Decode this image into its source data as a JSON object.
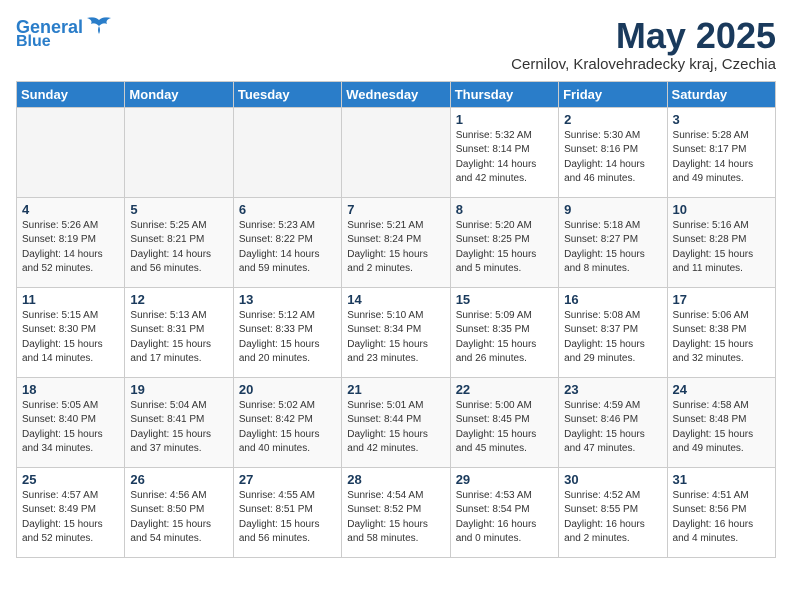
{
  "header": {
    "logo_line1": "General",
    "logo_line2": "Blue",
    "title": "May 2025",
    "subtitle": "Cernilov, Kralovehradecky kraj, Czechia"
  },
  "weekdays": [
    "Sunday",
    "Monday",
    "Tuesday",
    "Wednesday",
    "Thursday",
    "Friday",
    "Saturday"
  ],
  "weeks": [
    [
      {
        "day": "",
        "info": ""
      },
      {
        "day": "",
        "info": ""
      },
      {
        "day": "",
        "info": ""
      },
      {
        "day": "",
        "info": ""
      },
      {
        "day": "1",
        "info": "Sunrise: 5:32 AM\nSunset: 8:14 PM\nDaylight: 14 hours\nand 42 minutes."
      },
      {
        "day": "2",
        "info": "Sunrise: 5:30 AM\nSunset: 8:16 PM\nDaylight: 14 hours\nand 46 minutes."
      },
      {
        "day": "3",
        "info": "Sunrise: 5:28 AM\nSunset: 8:17 PM\nDaylight: 14 hours\nand 49 minutes."
      }
    ],
    [
      {
        "day": "4",
        "info": "Sunrise: 5:26 AM\nSunset: 8:19 PM\nDaylight: 14 hours\nand 52 minutes."
      },
      {
        "day": "5",
        "info": "Sunrise: 5:25 AM\nSunset: 8:21 PM\nDaylight: 14 hours\nand 56 minutes."
      },
      {
        "day": "6",
        "info": "Sunrise: 5:23 AM\nSunset: 8:22 PM\nDaylight: 14 hours\nand 59 minutes."
      },
      {
        "day": "7",
        "info": "Sunrise: 5:21 AM\nSunset: 8:24 PM\nDaylight: 15 hours\nand 2 minutes."
      },
      {
        "day": "8",
        "info": "Sunrise: 5:20 AM\nSunset: 8:25 PM\nDaylight: 15 hours\nand 5 minutes."
      },
      {
        "day": "9",
        "info": "Sunrise: 5:18 AM\nSunset: 8:27 PM\nDaylight: 15 hours\nand 8 minutes."
      },
      {
        "day": "10",
        "info": "Sunrise: 5:16 AM\nSunset: 8:28 PM\nDaylight: 15 hours\nand 11 minutes."
      }
    ],
    [
      {
        "day": "11",
        "info": "Sunrise: 5:15 AM\nSunset: 8:30 PM\nDaylight: 15 hours\nand 14 minutes."
      },
      {
        "day": "12",
        "info": "Sunrise: 5:13 AM\nSunset: 8:31 PM\nDaylight: 15 hours\nand 17 minutes."
      },
      {
        "day": "13",
        "info": "Sunrise: 5:12 AM\nSunset: 8:33 PM\nDaylight: 15 hours\nand 20 minutes."
      },
      {
        "day": "14",
        "info": "Sunrise: 5:10 AM\nSunset: 8:34 PM\nDaylight: 15 hours\nand 23 minutes."
      },
      {
        "day": "15",
        "info": "Sunrise: 5:09 AM\nSunset: 8:35 PM\nDaylight: 15 hours\nand 26 minutes."
      },
      {
        "day": "16",
        "info": "Sunrise: 5:08 AM\nSunset: 8:37 PM\nDaylight: 15 hours\nand 29 minutes."
      },
      {
        "day": "17",
        "info": "Sunrise: 5:06 AM\nSunset: 8:38 PM\nDaylight: 15 hours\nand 32 minutes."
      }
    ],
    [
      {
        "day": "18",
        "info": "Sunrise: 5:05 AM\nSunset: 8:40 PM\nDaylight: 15 hours\nand 34 minutes."
      },
      {
        "day": "19",
        "info": "Sunrise: 5:04 AM\nSunset: 8:41 PM\nDaylight: 15 hours\nand 37 minutes."
      },
      {
        "day": "20",
        "info": "Sunrise: 5:02 AM\nSunset: 8:42 PM\nDaylight: 15 hours\nand 40 minutes."
      },
      {
        "day": "21",
        "info": "Sunrise: 5:01 AM\nSunset: 8:44 PM\nDaylight: 15 hours\nand 42 minutes."
      },
      {
        "day": "22",
        "info": "Sunrise: 5:00 AM\nSunset: 8:45 PM\nDaylight: 15 hours\nand 45 minutes."
      },
      {
        "day": "23",
        "info": "Sunrise: 4:59 AM\nSunset: 8:46 PM\nDaylight: 15 hours\nand 47 minutes."
      },
      {
        "day": "24",
        "info": "Sunrise: 4:58 AM\nSunset: 8:48 PM\nDaylight: 15 hours\nand 49 minutes."
      }
    ],
    [
      {
        "day": "25",
        "info": "Sunrise: 4:57 AM\nSunset: 8:49 PM\nDaylight: 15 hours\nand 52 minutes."
      },
      {
        "day": "26",
        "info": "Sunrise: 4:56 AM\nSunset: 8:50 PM\nDaylight: 15 hours\nand 54 minutes."
      },
      {
        "day": "27",
        "info": "Sunrise: 4:55 AM\nSunset: 8:51 PM\nDaylight: 15 hours\nand 56 minutes."
      },
      {
        "day": "28",
        "info": "Sunrise: 4:54 AM\nSunset: 8:52 PM\nDaylight: 15 hours\nand 58 minutes."
      },
      {
        "day": "29",
        "info": "Sunrise: 4:53 AM\nSunset: 8:54 PM\nDaylight: 16 hours\nand 0 minutes."
      },
      {
        "day": "30",
        "info": "Sunrise: 4:52 AM\nSunset: 8:55 PM\nDaylight: 16 hours\nand 2 minutes."
      },
      {
        "day": "31",
        "info": "Sunrise: 4:51 AM\nSunset: 8:56 PM\nDaylight: 16 hours\nand 4 minutes."
      }
    ]
  ]
}
